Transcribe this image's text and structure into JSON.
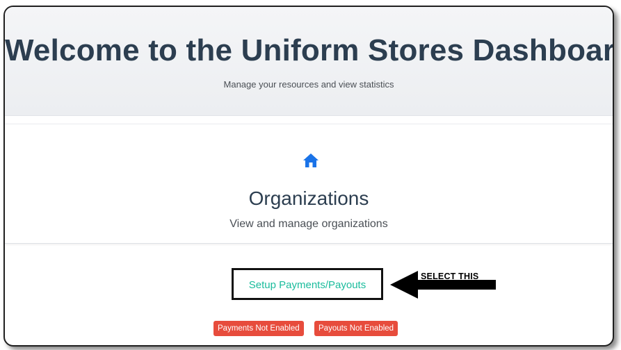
{
  "header": {
    "title": "Welcome to the Uniform Stores Dashboard",
    "subtitle": "Manage your resources and view statistics"
  },
  "organizations_card": {
    "icon": "home-icon",
    "title": "Organizations",
    "subtitle": "View and manage organizations"
  },
  "actions": {
    "setup_link": "Setup Payments/Payouts"
  },
  "annotation": {
    "text": "SELECT THIS"
  },
  "status_badges": [
    {
      "label": "Payments Not Enabled",
      "color": "#e74c3c"
    },
    {
      "label": "Payouts Not Enabled",
      "color": "#e74c3c"
    }
  ],
  "colors": {
    "title": "#2c3e50",
    "link": "#1abc9c",
    "accent_icon": "#1a73e8",
    "badge": "#e74c3c"
  }
}
